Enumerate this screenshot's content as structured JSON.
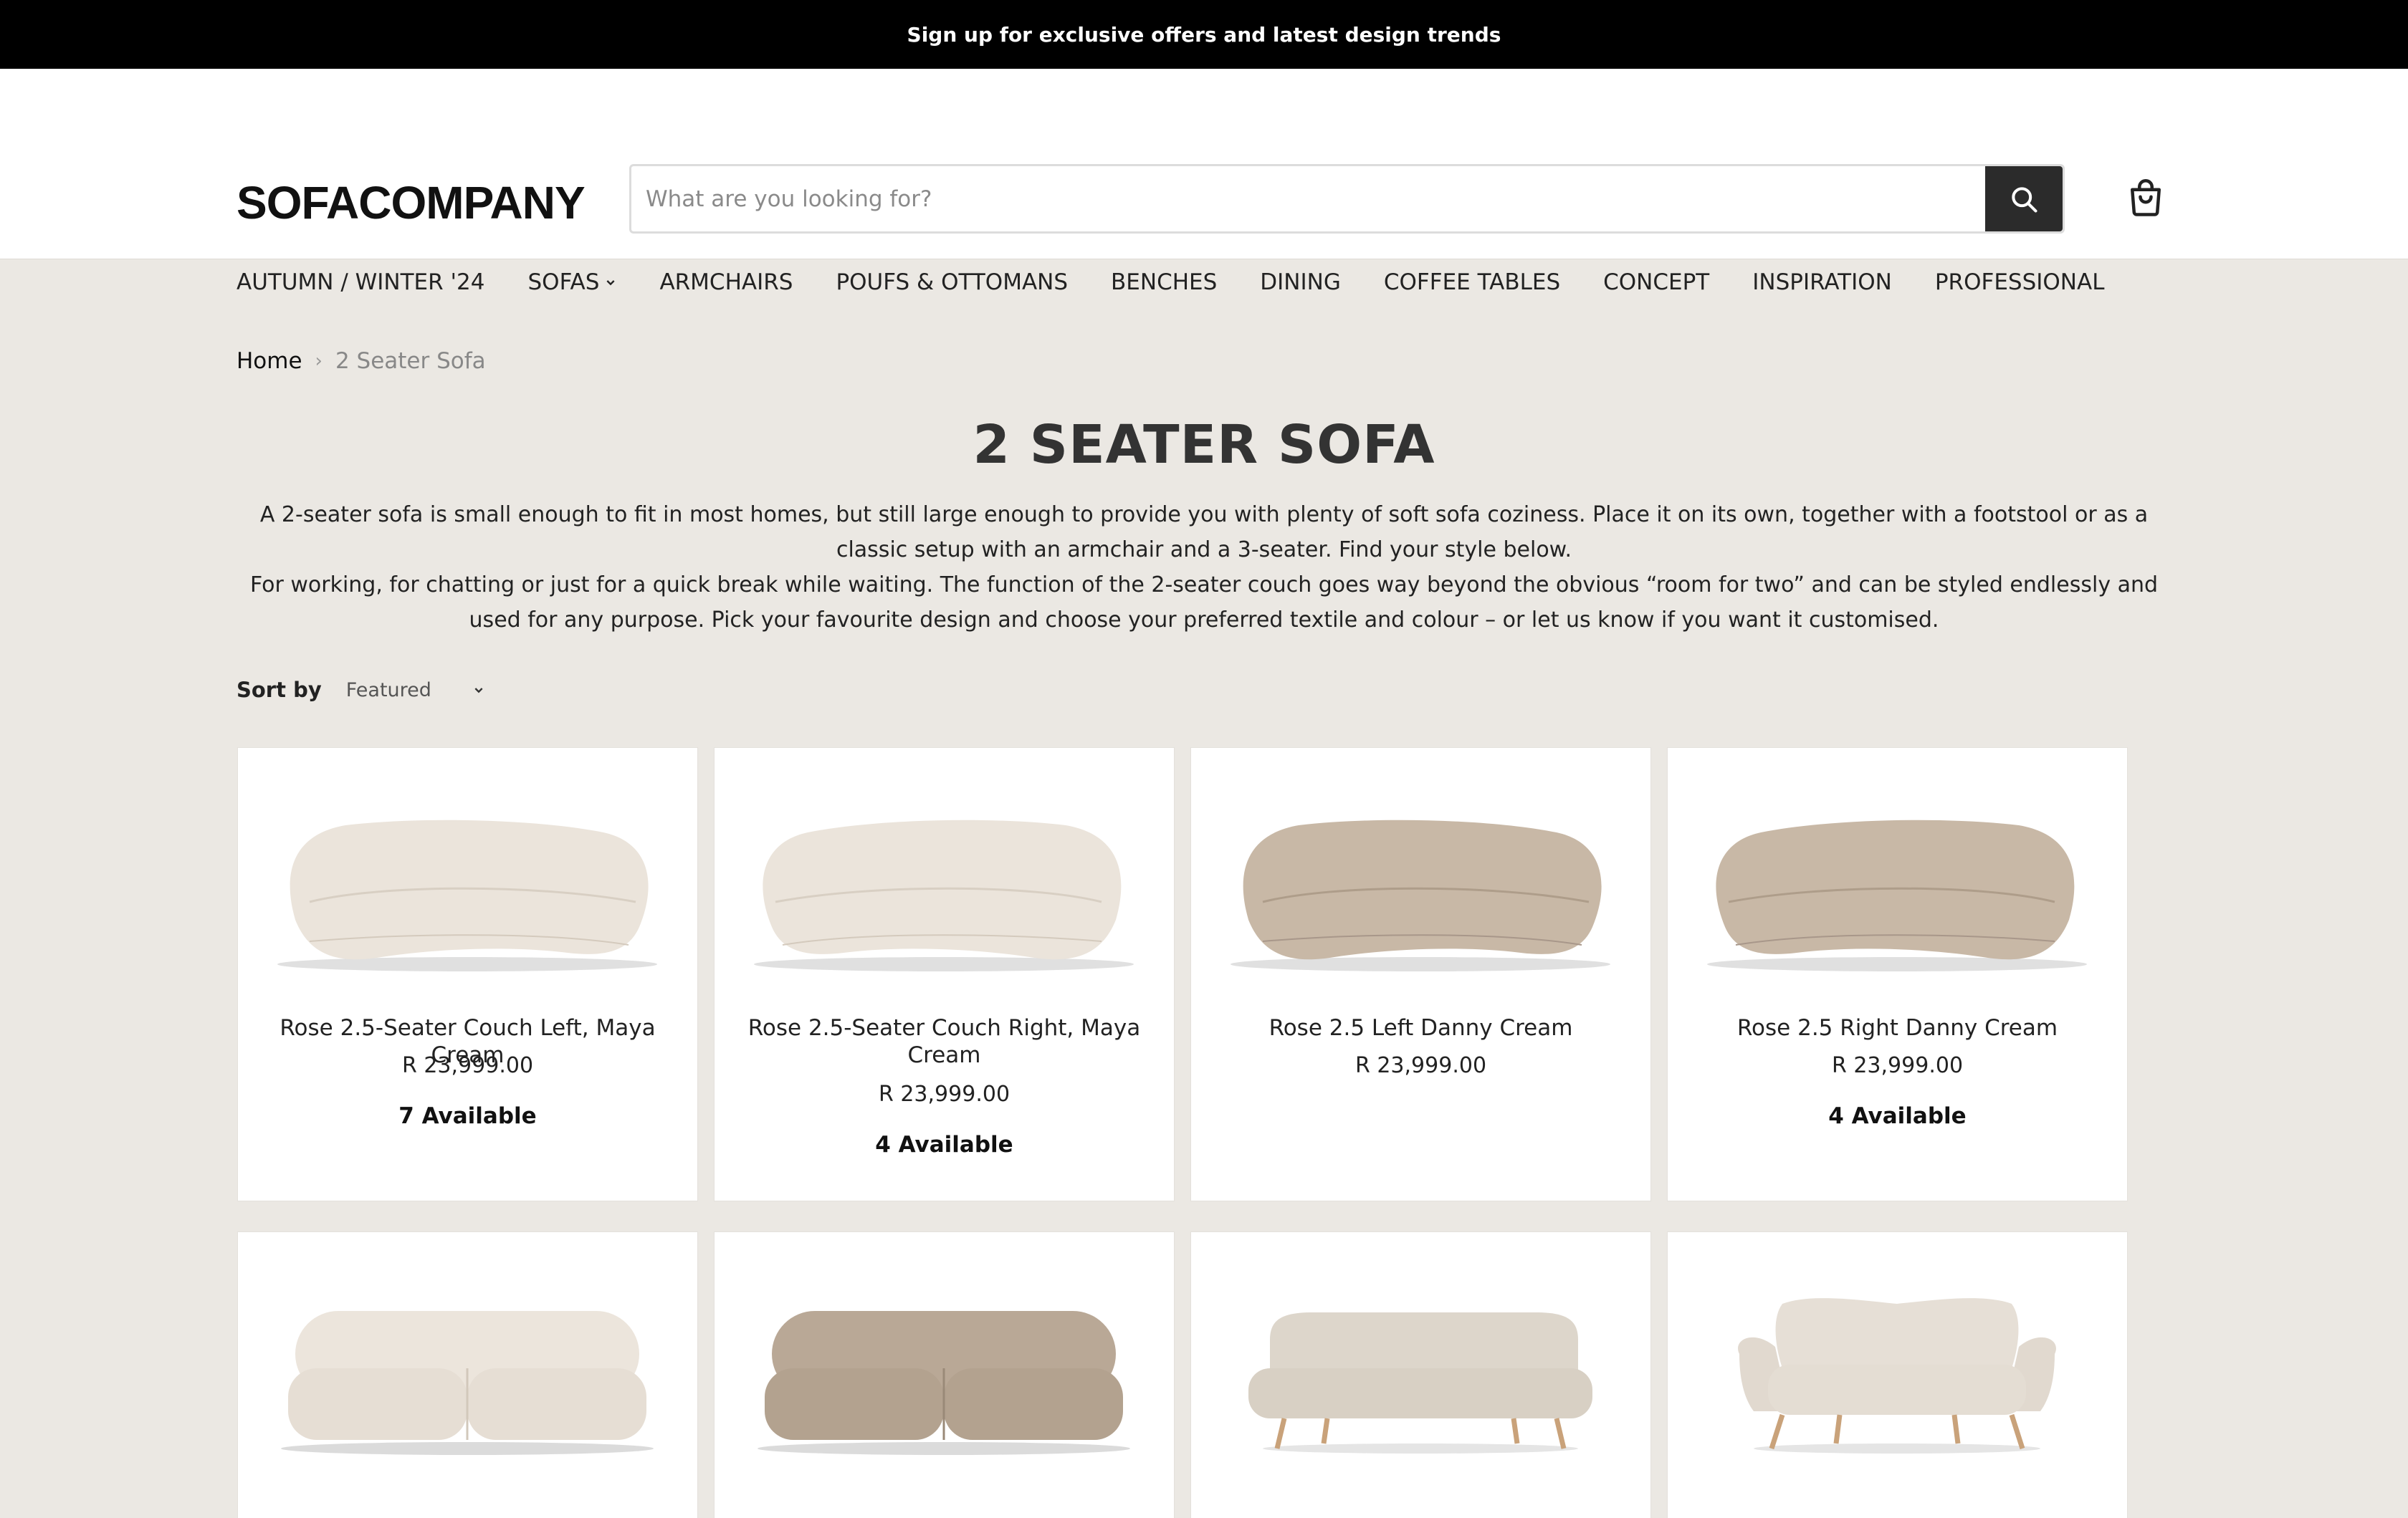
{
  "promo": {
    "text": "Sign up for exclusive offers and latest design trends"
  },
  "header": {
    "logo": "SOFACOMPANY",
    "search_placeholder": "What are you looking for?"
  },
  "nav": {
    "items": [
      {
        "label": "AUTUMN / WINTER '24"
      },
      {
        "label": "SOFAS",
        "has_dropdown": true
      },
      {
        "label": "ARMCHAIRS"
      },
      {
        "label": "POUFS & OTTOMANS"
      },
      {
        "label": "BENCHES"
      },
      {
        "label": "DINING"
      },
      {
        "label": "COFFEE TABLES"
      },
      {
        "label": "CONCEPT"
      },
      {
        "label": "INSPIRATION"
      },
      {
        "label": "PROFESSIONAL"
      }
    ]
  },
  "breadcrumb": {
    "home": "Home",
    "separator": "›",
    "current": "2 Seater Sofa"
  },
  "page": {
    "title": "2 SEATER SOFA",
    "description_p1": "A 2-seater sofa is small enough to fit in most homes, but still large enough to provide you with plenty of soft sofa coziness. Place it on its own, together with a footstool or as a classic setup with an armchair and a 3-seater. Find your style below.",
    "description_p2": "For working, for chatting or just for a quick break while waiting. The function of the 2-seater couch goes way beyond the obvious “room for two” and can be styled endlessly and used for any purpose. Pick your favourite design and choose your preferred textile and colour – or let us know if you want it customised."
  },
  "sort": {
    "label": "Sort by",
    "selected": "Featured"
  },
  "products": [
    {
      "name": "Rose 2.5-Seater Couch Left, Maya Cream",
      "price": "R 23,999.00",
      "stock": "7 Available",
      "image": "curved-sofa-cream-left-image",
      "color": "#eae3da"
    },
    {
      "name": "Rose 2.5-Seater Couch Right, Maya Cream",
      "price": "R 23,999.00",
      "stock": "4 Available",
      "image": "curved-sofa-cream-right-image",
      "color": "#eae3da"
    },
    {
      "name": "Rose 2.5 Left Danny Cream",
      "price": "R 23,999.00",
      "stock": "",
      "image": "curved-sofa-taupe-left-image",
      "color": "#c9b9a7"
    },
    {
      "name": "Rose 2.5 Right Danny Cream",
      "price": "R 23,999.00",
      "stock": "4 Available",
      "image": "curved-sofa-taupe-right-image",
      "color": "#c9b9a7"
    },
    {
      "name": "",
      "price": "",
      "stock": "",
      "image": "modular-sofa-cream-image",
      "color": "#e8e1d8"
    },
    {
      "name": "",
      "price": "",
      "stock": "",
      "image": "modular-sofa-taupe-image",
      "color": "#b8a795"
    },
    {
      "name": "",
      "price": "",
      "stock": "",
      "image": "legged-sofa-beige-image",
      "color": "#dcd5ca"
    },
    {
      "name": "",
      "price": "",
      "stock": "",
      "image": "retro-loveseat-cream-image",
      "color": "#e4ddd4"
    }
  ]
}
